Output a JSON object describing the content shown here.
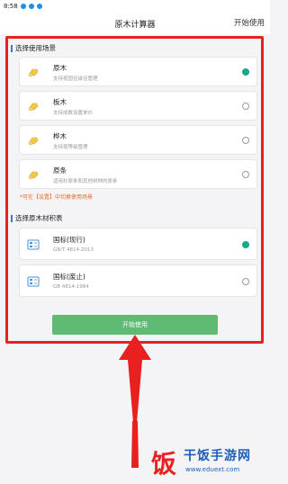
{
  "statusbar": {
    "time": "8:58"
  },
  "header": {
    "title": "原木计算器",
    "action": "开始使用"
  },
  "scenes": {
    "heading": "选择使用场景",
    "items": [
      {
        "title": "原木",
        "subtitle": "支持按国径级径管理"
      },
      {
        "title": "板木",
        "subtitle": "支持成数设置单价"
      },
      {
        "title": "桦木",
        "subtitle": "支持按等级管理"
      },
      {
        "title": "原条",
        "subtitle": "适用杉原条和其他树种的原条"
      }
    ],
    "selected": 0,
    "note": "*可在【设置】中切换使用场景"
  },
  "standards": {
    "heading": "选择原木材积表",
    "items": [
      {
        "title": "国标(现行)",
        "subtitle": "GB/T 4814-2013"
      },
      {
        "title": "国标(废止)",
        "subtitle": "GB 4814-1984"
      }
    ],
    "selected": 0
  },
  "start_button": {
    "label": "开始使用"
  },
  "watermark": {
    "name": "干饭手游网",
    "url": "www.eduext.com",
    "logo": "饭"
  },
  "colors": {
    "accent_green": "#5fba73",
    "radio_on": "#19a888",
    "highlight_red": "#e8201f",
    "note_orange": "#e86a2a"
  }
}
